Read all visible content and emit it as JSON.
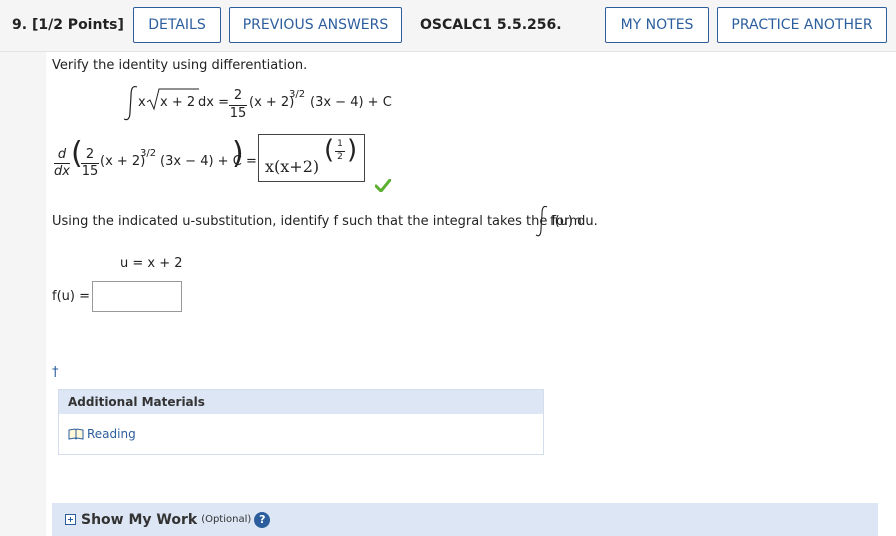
{
  "header": {
    "question_number": "9.",
    "points": "[1/2 Points]",
    "details_label": "DETAILS",
    "previous_answers_label": "PREVIOUS ANSWERS",
    "problem_code": "OSCALC1 5.5.256.",
    "my_notes_label": "MY NOTES",
    "practice_another_label": "PRACTICE ANOTHER"
  },
  "question": {
    "instruction": "Verify the identity using differentiation.",
    "identity": {
      "lhs_integrand_x": "x",
      "lhs_radicand": "x + 2",
      "lhs_dx": "dx =",
      "coef_num": "2",
      "coef_den": "15",
      "rhs_tail_a": "(x + 2)",
      "rhs_exponent": "3/2",
      "rhs_tail_b": "(3x − 4) + C"
    },
    "derivative": {
      "d_num": "d",
      "d_den": "dx",
      "coef_num": "2",
      "coef_den": "15",
      "inner_a": "(x + 2)",
      "inner_exponent": "3/2",
      "inner_b": "(3x − 4) + C",
      "equals": "=",
      "answer_base": "x(x+2)",
      "answer_exp_num": "1",
      "answer_exp_den": "2"
    },
    "substitution_prompt": "Using the indicated u-substitution, identify f such that the integral takes the form",
    "form": "f(u) du.",
    "substitution": "u = x + 2",
    "fu_label": "f(u) =",
    "fu_value": "",
    "dagger": "†"
  },
  "materials": {
    "heading": "Additional Materials",
    "reading_label": "Reading"
  },
  "show_my_work": {
    "label": "Show My Work",
    "optional": "(Optional)",
    "help": "?"
  },
  "colors": {
    "accent": "#2c5e9e",
    "check": "#5cb030",
    "panel": "#dce6f4"
  }
}
